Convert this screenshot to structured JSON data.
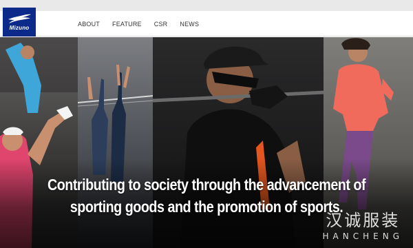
{
  "header": {
    "logo": {
      "text": "Mizuno",
      "icon": "mizuno-runbird-icon"
    },
    "nav": [
      {
        "label": "ABOUT"
      },
      {
        "label": "FEATURE"
      },
      {
        "label": "CSR"
      },
      {
        "label": "NEWS"
      }
    ]
  },
  "hero": {
    "headline_line1": "Contributing to society through the advancement of",
    "headline_line2": "sporting goods and the promotion of sports."
  },
  "watermark": {
    "chinese": "汉诚服装",
    "english": "HANCHENG"
  },
  "colors": {
    "logo_bg": "#0b2a8a",
    "nav_text": "#333333",
    "headline_text": "#ffffff"
  }
}
